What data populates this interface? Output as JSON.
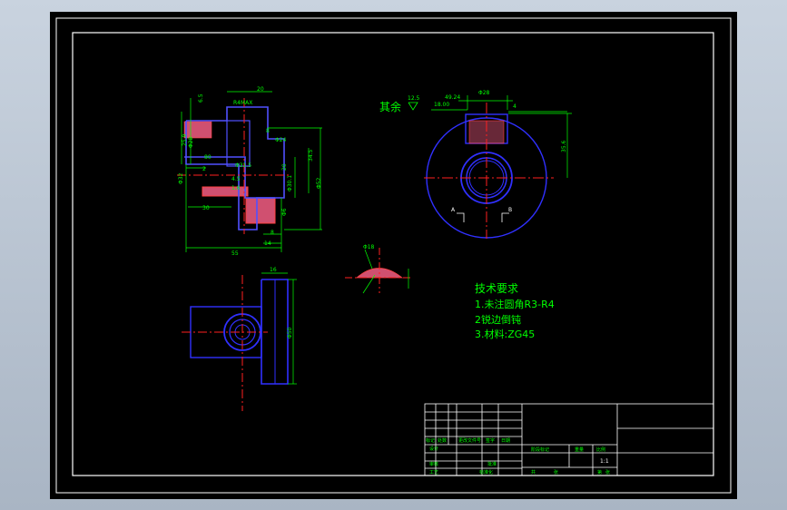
{
  "drawing": {
    "roughness_note": "其余",
    "roughness_value": "12.5",
    "tech_title": "技术要求",
    "tech_items": [
      "1.未注圆角R3-R4",
      "2锐边倒钝",
      "3.材料:ZG45"
    ],
    "scale": "1:1"
  },
  "dims": {
    "front": [
      "20",
      "R4MAX",
      "6.5",
      "Φ28",
      "25.9",
      "8",
      "Φ24",
      "Φ31.5",
      "2",
      "Φ32",
      "4.5",
      "20",
      "Φ30.1",
      "Φ52",
      "30",
      "Φ6",
      "34.5",
      "55",
      "8",
      "14",
      "1.6",
      "80"
    ],
    "side": [
      "49.24",
      "Φ28",
      "18.00",
      "4",
      "35.6",
      "A",
      "B"
    ],
    "bottom": [
      "16",
      "Φ50"
    ],
    "section": [
      "Φ18"
    ]
  },
  "title_block": {
    "labels": [
      "标记",
      "处数",
      "更改文件号",
      "签字",
      "日期",
      "设计",
      "标准化",
      "阶段标记",
      "重量",
      "比例",
      "审核",
      "工艺",
      "批准",
      "共",
      "张",
      "第",
      "张"
    ]
  },
  "colors": {
    "background": "#000000",
    "outline": "#ffffff",
    "dimension": "#00ff00",
    "centerline": "#ff0000",
    "part": "#0000ff",
    "hatch": "#ff0000",
    "frame_bg": "#b2bccb"
  }
}
